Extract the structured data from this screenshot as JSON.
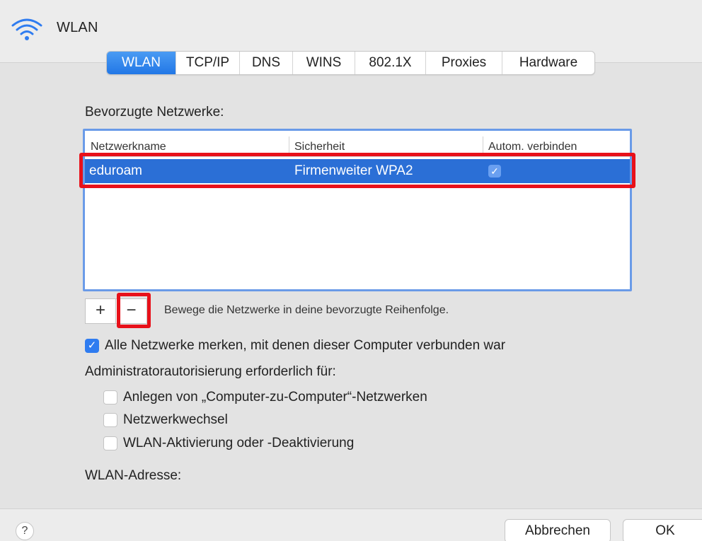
{
  "window": {
    "title": "WLAN"
  },
  "tabs": [
    {
      "label": "WLAN",
      "active": true
    },
    {
      "label": "TCP/IP",
      "active": false
    },
    {
      "label": "DNS",
      "active": false
    },
    {
      "label": "WINS",
      "active": false
    },
    {
      "label": "802.1X",
      "active": false
    },
    {
      "label": "Proxies",
      "active": false
    },
    {
      "label": "Hardware",
      "active": false
    }
  ],
  "preferred_networks": {
    "label": "Bevorzugte Netzwerke:",
    "columns": [
      "Netzwerkname",
      "Sicherheit",
      "Autom. verbinden"
    ],
    "rows": [
      {
        "name": "eduroam",
        "security": "Firmenweiter WPA2",
        "auto_connect": true,
        "selected": true
      }
    ],
    "add_label": "+",
    "remove_label": "−",
    "hint": "Bewege die Netzwerke in deine bevorzugte Reihenfolge."
  },
  "options": {
    "remember_networks": {
      "label": "Alle Netzwerke merken, mit denen dieser Computer verbunden war",
      "checked": true
    },
    "admin_required_label": "Administratorautorisierung erforderlich für:",
    "admin_items": [
      {
        "label": "Anlegen von „Computer-zu-Computer“-Netzwerken",
        "checked": false
      },
      {
        "label": "Netzwerkwechsel",
        "checked": false
      },
      {
        "label": "WLAN-Aktivierung oder -Deaktivierung",
        "checked": false
      }
    ],
    "wlan_address_label": "WLAN-Adresse:"
  },
  "footer": {
    "help_label": "?",
    "cancel_label": "Abbrechen",
    "ok_label": "OK"
  },
  "colors": {
    "accent": "#2b6fd6",
    "highlight_annotation": "#e8111a"
  },
  "icons": {
    "title": "wifi-icon",
    "checkmark": "checkmark-icon"
  }
}
